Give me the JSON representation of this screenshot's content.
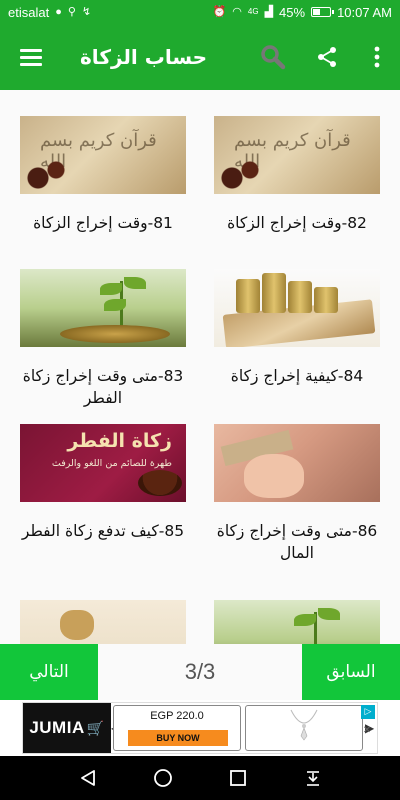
{
  "status_bar": {
    "carrier": "etisalat",
    "network_label": "4G",
    "battery_text": "45%",
    "battery_level": 0.45,
    "time": "10:07 AM"
  },
  "app_bar": {
    "title": "حساب الزكاة",
    "icons": [
      "menu-icon",
      "search-icon",
      "share-icon",
      "more-vert-icon"
    ],
    "color": "#1faa2e"
  },
  "items": [
    {
      "caption": "82-وقت إخراج الزكاة",
      "thumb": "quran-script"
    },
    {
      "caption": "81-وقت إخراج الزكاة",
      "thumb": "quran-script"
    },
    {
      "caption": "84-كيفية إخراج زكاة",
      "thumb": "money-stacks"
    },
    {
      "caption": "83-متى وقت إخراج زكاة الفطر",
      "thumb": "plant-coins"
    },
    {
      "caption": "86-متى وقت إخراج زكاة المال",
      "thumb": "child-money"
    },
    {
      "caption": "85-كيف تدفع زكاة الفطر",
      "thumb": "zakat-fitr-banner"
    },
    {
      "caption": "",
      "thumb": "plant-coins"
    },
    {
      "caption": "",
      "thumb": "money-bag"
    }
  ],
  "banner": {
    "title": "زكاة الفطر",
    "subtitle": "طهرة للصائم من اللغو والرفث"
  },
  "pager": {
    "next_label": "التالي",
    "prev_label": "السابق",
    "indicator": "3/3",
    "color": "#12c63a"
  },
  "ad": {
    "brand": "JUMIA",
    "price": "EGP 220.0",
    "buy_label": "BUY NOW",
    "accent": "#f68b1e"
  },
  "nav": {
    "icons": [
      "back-icon",
      "home-icon",
      "recents-icon",
      "notification-pull-icon"
    ]
  }
}
